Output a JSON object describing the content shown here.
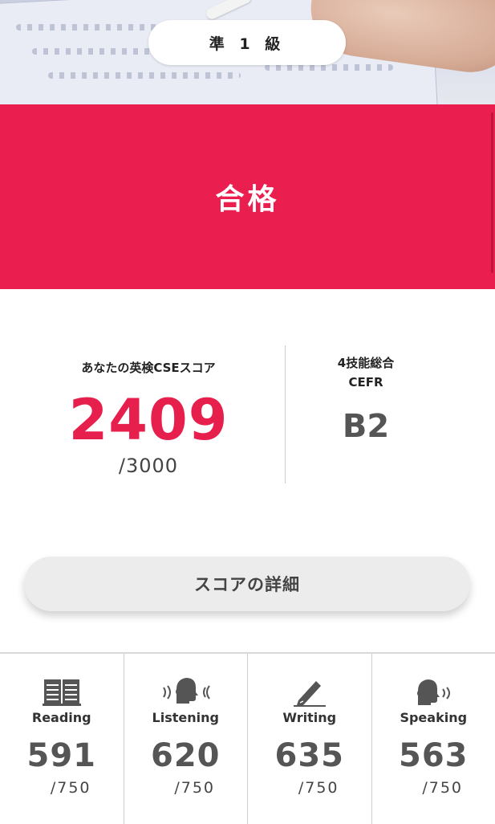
{
  "grade": {
    "label": "準 1 級"
  },
  "result": {
    "text": "合格"
  },
  "score": {
    "label": "あなたの英検CSEスコア",
    "value": "2409",
    "max": "/3000"
  },
  "cefr_overall": {
    "line1": "4技能総合",
    "line2": "CEFR",
    "value": "B2"
  },
  "detail_button": {
    "label": "スコアの詳細"
  },
  "skills": [
    {
      "name": "Reading",
      "score": "591",
      "max": "/750",
      "icon": "book-icon"
    },
    {
      "name": "Listening",
      "score": "620",
      "max": "/750",
      "icon": "listening-head-icon"
    },
    {
      "name": "Writing",
      "score": "635",
      "max": "/750",
      "icon": "pencil-icon"
    },
    {
      "name": "Speaking",
      "score": "563",
      "max": "/750",
      "icon": "speaking-head-icon"
    }
  ],
  "colors": {
    "accent": "#ea1f50",
    "score": "#e71f4d"
  }
}
